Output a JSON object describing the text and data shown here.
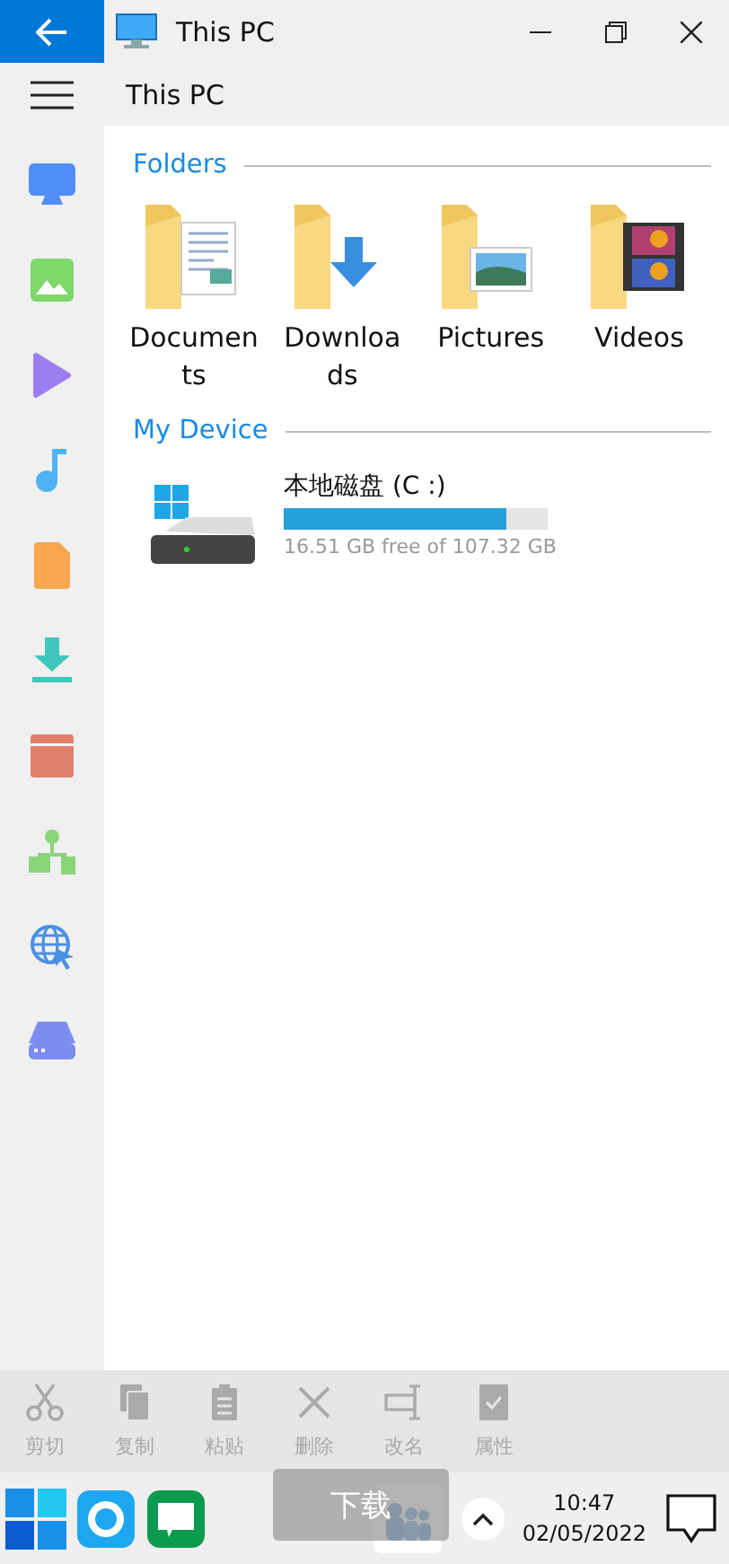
{
  "window": {
    "title": "This PC"
  },
  "breadcrumb": "This PC",
  "folders_section": {
    "title": "Folders",
    "items": [
      {
        "name": "Documents"
      },
      {
        "name": "Downloads"
      },
      {
        "name": "Pictures"
      },
      {
        "name": "Videos"
      }
    ]
  },
  "device_section": {
    "title": "My Device",
    "drives": [
      {
        "name": "本地磁盘 (C :)",
        "level": 0.846,
        "free_text": "16.51 GB free of 107.32 GB"
      }
    ]
  },
  "toolbar": [
    {
      "label": "剪切",
      "disabled": true
    },
    {
      "label": "复制",
      "disabled": true
    },
    {
      "label": "粘贴",
      "disabled": true
    },
    {
      "label": "删除",
      "disabled": true
    },
    {
      "label": "改名",
      "disabled": true
    },
    {
      "label": "属性",
      "disabled": true
    }
  ],
  "toast": "下载",
  "taskbar": {
    "time": "10:47",
    "date": "02/05/2022"
  }
}
